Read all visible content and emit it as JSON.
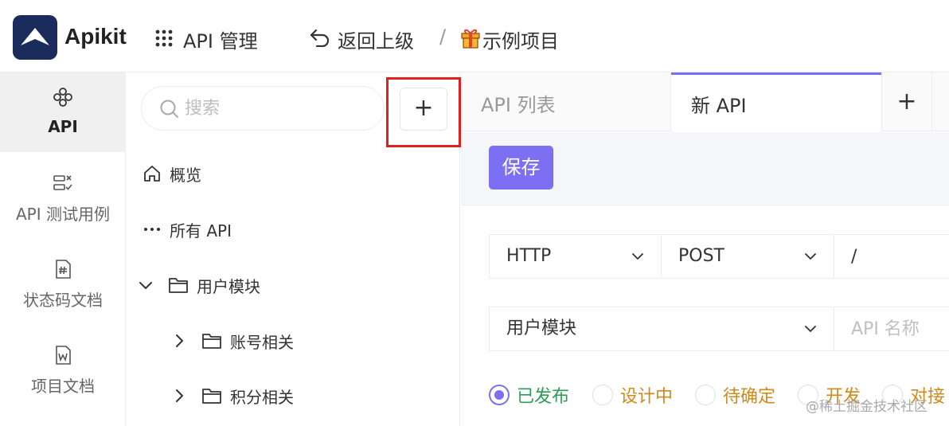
{
  "header": {
    "app_name": "Apikit",
    "api_manage_label": "API 管理",
    "back_label": "返回上级",
    "separator": "/",
    "project_name": "示例项目"
  },
  "rail": {
    "items": [
      {
        "label": "API",
        "icon": "api-icon",
        "active": true
      },
      {
        "label": "API 测试用例",
        "icon": "test-case-icon"
      },
      {
        "label": "状态码文档",
        "icon": "status-code-doc-icon"
      },
      {
        "label": "项目文档",
        "icon": "project-doc-icon"
      }
    ]
  },
  "tree": {
    "search_placeholder": "搜索",
    "add_label": "+",
    "items": [
      {
        "label": "概览",
        "icon": "home-icon"
      },
      {
        "label": "所有 API",
        "icon": "more-icon"
      },
      {
        "label": "用户模块",
        "icon": "folder-icon",
        "expanded": true
      },
      {
        "label": "账号相关",
        "icon": "folder-icon",
        "expanded": false
      },
      {
        "label": "积分相关",
        "icon": "folder-icon",
        "expanded": false
      }
    ]
  },
  "main": {
    "tabs": [
      {
        "label": "API 列表"
      },
      {
        "label": "新 API",
        "active": true
      }
    ],
    "tab_add_label": "+",
    "save_label": "保存",
    "protocol": "HTTP",
    "method": "POST",
    "path": "/",
    "group": "用户模块",
    "name_placeholder": "API 名称",
    "status_options": [
      {
        "label": "已发布",
        "color": "#2e9b55",
        "checked": true
      },
      {
        "label": "设计中",
        "color": "#d08a1c"
      },
      {
        "label": "待确定",
        "color": "#d08a1c"
      },
      {
        "label": "开发",
        "color": "#d08a1c"
      },
      {
        "label": "对接",
        "color": "#d08a1c"
      }
    ]
  },
  "watermark": "@稀土掘金技术社区",
  "colors": {
    "accent": "#7c6ff2",
    "highlight_border": "#e02020",
    "logo_bg": "#1b2b5c"
  }
}
